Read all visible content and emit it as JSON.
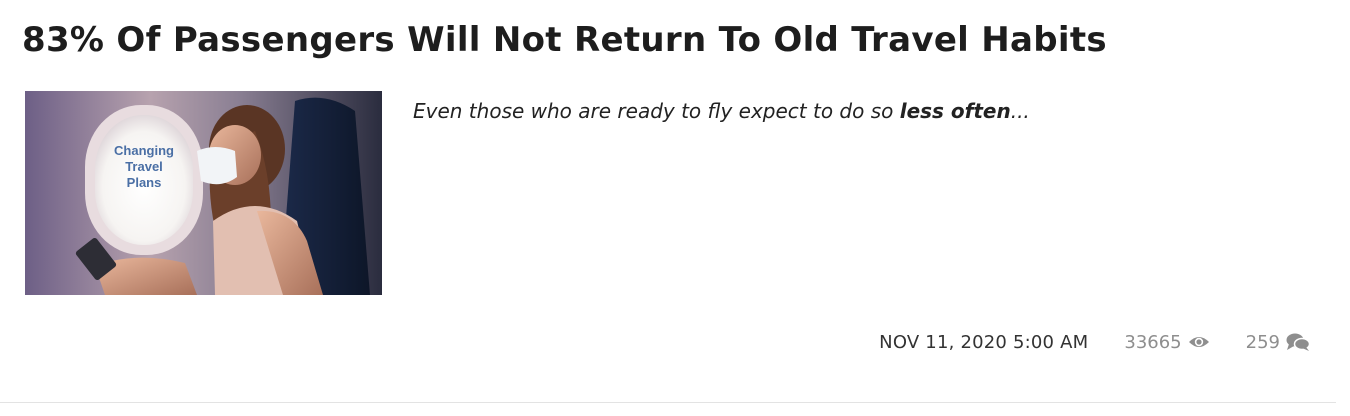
{
  "article": {
    "title": "83% Of Passengers Will Not Return To Old Travel Habits",
    "thumbnail": {
      "caption_lines": [
        "Changing",
        "Travel",
        "Plans"
      ]
    },
    "excerpt": {
      "text_before": "Even those who are ready to fly expect to do so ",
      "emphasis": "less often",
      "text_after": "..."
    },
    "meta": {
      "date": "NOV 11, 2020 5:00 AM",
      "views": "33665",
      "comments": "259",
      "views_icon": "eye-icon",
      "comments_icon": "comments-icon"
    }
  },
  "colors": {
    "title": "#1d1d1d",
    "meta_muted": "#8e8e8e",
    "window_text": "#4a6fa5"
  }
}
